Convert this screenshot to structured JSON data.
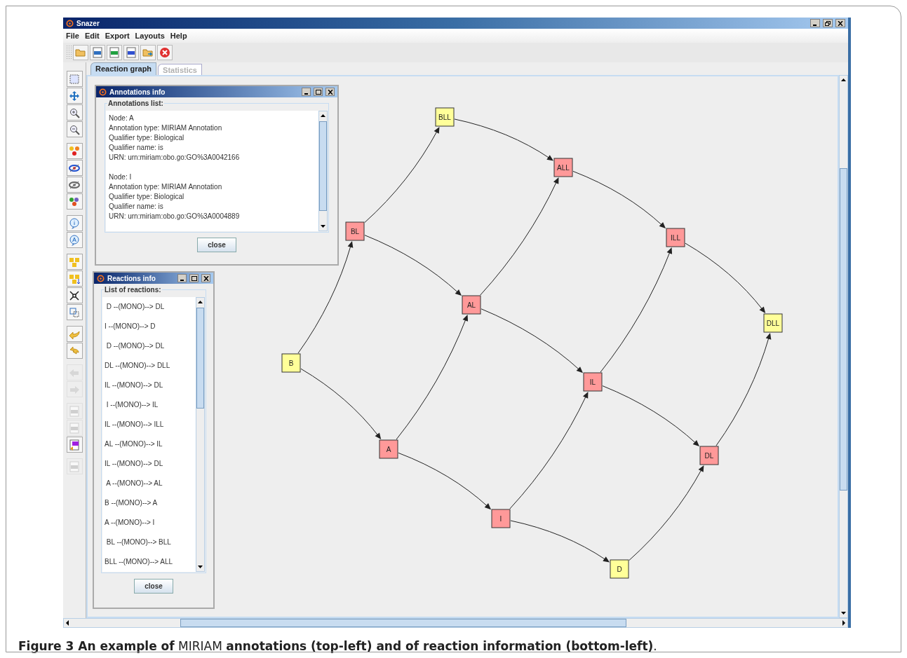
{
  "window": {
    "title": "Snazer",
    "controls": [
      {
        "kind": "minimize"
      },
      {
        "kind": "restore"
      },
      {
        "kind": "close"
      }
    ]
  },
  "menu": [
    {
      "label": "File"
    },
    {
      "label": "Edit"
    },
    {
      "label": "Export"
    },
    {
      "label": "Layouts"
    },
    {
      "label": "Help"
    }
  ],
  "toolbar": [
    {
      "kind": "open"
    },
    {
      "kind": "xml"
    },
    {
      "kind": "csv"
    },
    {
      "kind": "sbml"
    },
    {
      "kind": "folder-arrow"
    },
    {
      "kind": "stop"
    }
  ],
  "side_tools": [
    [
      {
        "kind": "select",
        "disabled": false
      },
      {
        "kind": "move",
        "disabled": false
      },
      {
        "kind": "zoom-in",
        "disabled": false
      },
      {
        "kind": "zoom-out",
        "disabled": false
      }
    ],
    [
      {
        "kind": "nodes",
        "disabled": false
      },
      {
        "kind": "eye",
        "disabled": false
      },
      {
        "kind": "eye-off",
        "disabled": false
      },
      {
        "kind": "balls",
        "disabled": false
      }
    ],
    [
      {
        "kind": "info",
        "disabled": false
      },
      {
        "kind": "annot",
        "disabled": false
      }
    ],
    [
      {
        "kind": "group",
        "disabled": false
      },
      {
        "kind": "group-move",
        "disabled": false
      },
      {
        "kind": "collapse",
        "disabled": false
      },
      {
        "kind": "fit",
        "disabled": false
      }
    ],
    [
      {
        "kind": "undo",
        "disabled": false
      },
      {
        "kind": "redo",
        "disabled": false
      }
    ],
    [
      {
        "kind": "back",
        "disabled": true
      },
      {
        "kind": "forward",
        "disabled": true
      }
    ],
    [
      {
        "kind": "doc",
        "disabled": true
      },
      {
        "kind": "doc",
        "disabled": true
      },
      {
        "kind": "sbml-import",
        "disabled": false
      }
    ],
    [
      {
        "kind": "doc",
        "disabled": true
      }
    ]
  ],
  "tabs": [
    {
      "label": "Reaction graph",
      "selected": true
    },
    {
      "label": "Statistics",
      "selected": false
    }
  ],
  "annotations_window": {
    "title": "Annotations info",
    "group_label": "Annotations list:",
    "entries": [
      {
        "lines": [
          "Node: A",
          "Annotation type: MIRIAM Annotation",
          "Qualifier type: Biological",
          "Qualifier name: is",
          "URN: urn:miriam:obo.go:GO%3A0042166"
        ]
      },
      {
        "lines": [
          "Node: I",
          "Annotation type: MIRIAM Annotation",
          "Qualifier type: Biological",
          "Qualifier name: is",
          "URN: urn:miriam:obo.go:GO%3A0004889"
        ]
      }
    ],
    "button": "close"
  },
  "reactions_window": {
    "title": "Reactions info",
    "group_label": "List of reactions:",
    "items": [
      " D --(MONO)--> DL",
      "I --(MONO)--> D",
      " D --(MONO)--> DL",
      "DL --(MONO)--> DLL",
      "IL --(MONO)--> DL",
      " I --(MONO)--> IL",
      "IL --(MONO)--> ILL",
      "AL --(MONO)--> IL",
      "IL --(MONO)--> DL",
      " A --(MONO)--> AL",
      "B --(MONO)--> A",
      "A --(MONO)--> I",
      " BL --(MONO)--> BLL",
      "BLL --(MONO)--> ALL"
    ],
    "button": "close"
  },
  "graph": {
    "nodes": [
      {
        "label": "BLL",
        "color": "#ffff99"
      },
      {
        "label": "ALL",
        "color": "#ff9999"
      },
      {
        "label": "BL",
        "color": "#ff9999"
      },
      {
        "label": "ILL",
        "color": "#ff9999"
      },
      {
        "label": "AL",
        "color": "#ff9999"
      },
      {
        "label": "DLL",
        "color": "#ffff99"
      },
      {
        "label": "B",
        "color": "#ffff99"
      },
      {
        "label": "IL",
        "color": "#ff9999"
      },
      {
        "label": "A",
        "color": "#ff9999"
      },
      {
        "label": "DL",
        "color": "#ff9999"
      },
      {
        "label": "I",
        "color": "#ff9999"
      },
      {
        "label": "D",
        "color": "#ffff99"
      }
    ]
  },
  "caption": "**Figure 3 An example of** MIRIAM **annotations (top-left) and of reaction information (bottom-left)**."
}
